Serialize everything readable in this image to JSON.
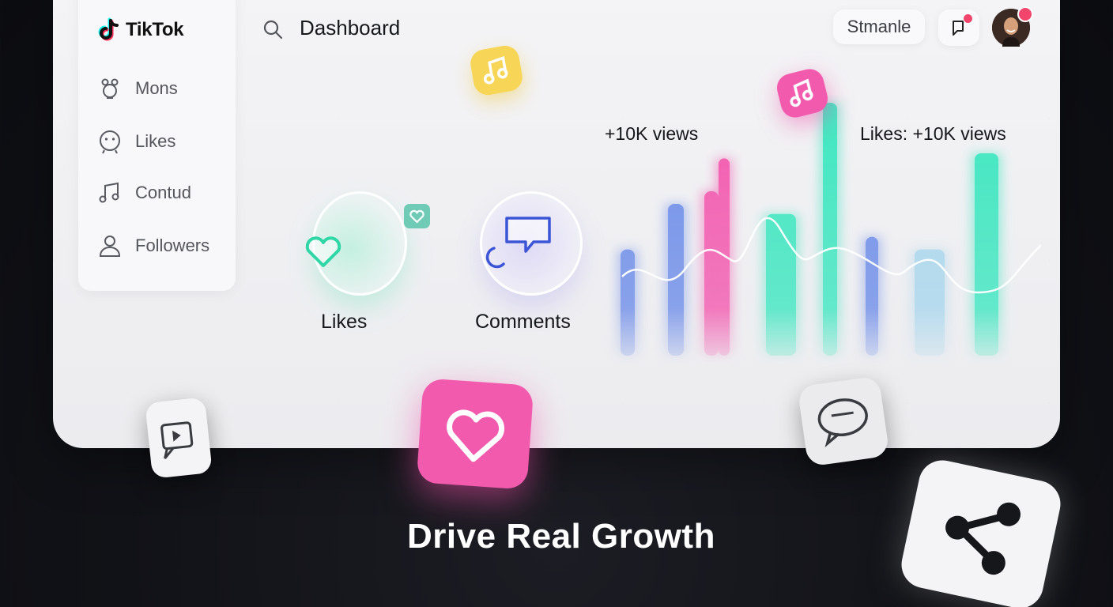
{
  "app": {
    "brand": "TikTok"
  },
  "sidebar": {
    "items": [
      {
        "label": "Mons",
        "icon": "robot-icon"
      },
      {
        "label": "Likes",
        "icon": "smiley-icon"
      },
      {
        "label": "Contud",
        "icon": "music-note-icon"
      },
      {
        "label": "Followers",
        "icon": "user-icon"
      }
    ]
  },
  "header": {
    "title": "Dashboard",
    "user_chip": "Stmanle"
  },
  "stats": {
    "likes_label": "Likes",
    "comments_label": "Comments"
  },
  "chart": {
    "annotation_left": "+10K views",
    "annotation_right": "Likes: +10K views"
  },
  "headline": "Drive Real Growth",
  "colors": {
    "accent_green": "#3fe6c0",
    "accent_pink": "#f25aae",
    "accent_blue": "#6f8ee8",
    "tile_yellow": "#f7d657",
    "background_dark": "#111217"
  },
  "chart_data": {
    "type": "bar",
    "series": [
      {
        "color": "#6f8ee8",
        "values": [
          0.42,
          0.6,
          0.0,
          0.0,
          0.0,
          0.0,
          0.47,
          0.0,
          0.0
        ]
      },
      {
        "color": "#f25aae",
        "values": [
          0.0,
          0.0,
          0.65,
          0.78,
          0.0,
          0.0,
          0.0,
          0.0,
          0.0
        ]
      },
      {
        "color": "#3fe6c0",
        "values": [
          0.0,
          0.0,
          0.0,
          0.0,
          0.56,
          1.0,
          0.0,
          0.0,
          0.8
        ]
      },
      {
        "color": "#a9d6ec",
        "values": [
          0.0,
          0.0,
          0.0,
          0.0,
          0.0,
          0.0,
          0.0,
          0.42,
          0.0
        ]
      }
    ]
  }
}
